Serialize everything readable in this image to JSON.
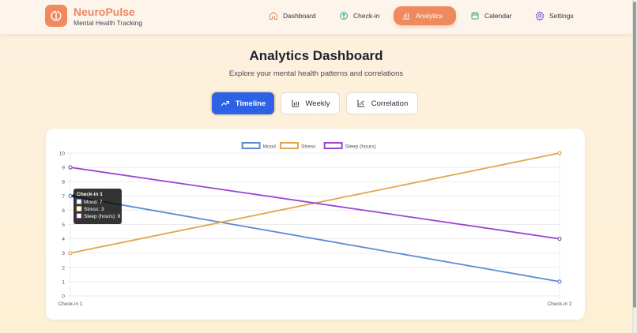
{
  "app": {
    "name": "NeuroPulse",
    "subtitle": "Mental Health Tracking",
    "brand_color": "#ea8760"
  },
  "nav": [
    {
      "label": "Dashboard",
      "icon": "home-icon",
      "active": false
    },
    {
      "label": "Check-in",
      "icon": "brain-icon",
      "active": false
    },
    {
      "label": "Analytics",
      "icon": "bar-chart-icon",
      "active": true
    },
    {
      "label": "Calendar",
      "icon": "calendar-icon",
      "active": false
    },
    {
      "label": "Settings",
      "icon": "gear-icon",
      "active": false
    }
  ],
  "page": {
    "title": "Analytics Dashboard",
    "subtitle": "Explore your mental health patterns and correlations"
  },
  "tabs": [
    {
      "label": "Timeline",
      "icon": "trend-icon",
      "active": true
    },
    {
      "label": "Weekly",
      "icon": "bar-chart-icon",
      "active": false
    },
    {
      "label": "Correlation",
      "icon": "scatter-icon",
      "active": false
    }
  ],
  "chart_data": {
    "type": "line",
    "categories": [
      "Check-in 1",
      "Check-in 2"
    ],
    "series": [
      {
        "name": "Mood",
        "values": [
          7,
          1
        ],
        "color": "#5b8ad6"
      },
      {
        "name": "Stress",
        "values": [
          3,
          10
        ],
        "color": "#e0a64f"
      },
      {
        "name": "Sleep (hours)",
        "values": [
          9,
          4
        ],
        "color": "#9a44d4"
      }
    ],
    "ylim": [
      0,
      10
    ],
    "yticks": [
      "0",
      "1",
      "2",
      "3",
      "4",
      "5",
      "6",
      "7",
      "8",
      "9",
      "10"
    ],
    "grid": true,
    "legend": "top-center",
    "tooltip": {
      "title": "Check-in 1",
      "lines": [
        "Mood: 7",
        "Stress: 3",
        "Sleep (hours): 9"
      ]
    }
  }
}
